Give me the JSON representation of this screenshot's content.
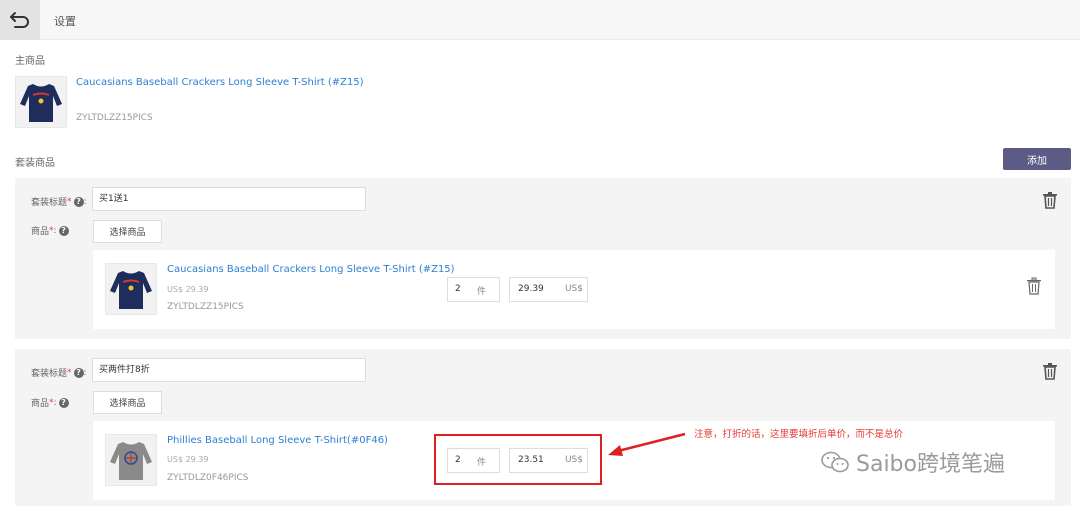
{
  "header": {
    "title": "设置"
  },
  "main_product": {
    "section_label": "主商品",
    "title": "Caucasians Baseball Crackers Long Sleeve T-Shirt (#Z15)",
    "sku": "ZYLTDLZZ15PICS"
  },
  "bundle_section": {
    "label": "套装商品",
    "add_label": "添加"
  },
  "bundles": [
    {
      "title_label": "套装标题",
      "title_value": "买1送1",
      "product_label": "商品",
      "select_label": "选择商品",
      "item": {
        "title": "Caucasians Baseball Crackers Long Sleeve T-Shirt (#Z15)",
        "price": "US$ 29.39",
        "sku": "ZYLTDLZZ15PICS",
        "qty": "2",
        "qty_unit": "件",
        "unit_price": "29.39",
        "currency": "US$"
      }
    },
    {
      "title_label": "套装标题",
      "title_value": "买两件打8折",
      "product_label": "商品",
      "select_label": "选择商品",
      "item": {
        "title": "Phillies Baseball Long Sleeve T-Shirt(#0F46)",
        "price": "US$ 29.39",
        "sku": "ZYLTDLZ0F46PICS",
        "qty": "2",
        "qty_unit": "件",
        "unit_price": "23.51",
        "currency": "US$"
      }
    }
  ],
  "annotation": {
    "text": "注意，打折的话，这里要填折后单价，而不是总价",
    "color": "#e53935"
  },
  "watermark": {
    "text": "Saibo跨境笔遍"
  },
  "colors": {
    "accent": "#5b5b86",
    "link": "#2d7fd4",
    "navy_shirt": "#1e2d5c",
    "grey_shirt": "#8a8a8a"
  },
  "icons": {
    "back": "back-arrow-icon",
    "help": "help-icon",
    "trash": "trash-icon"
  }
}
